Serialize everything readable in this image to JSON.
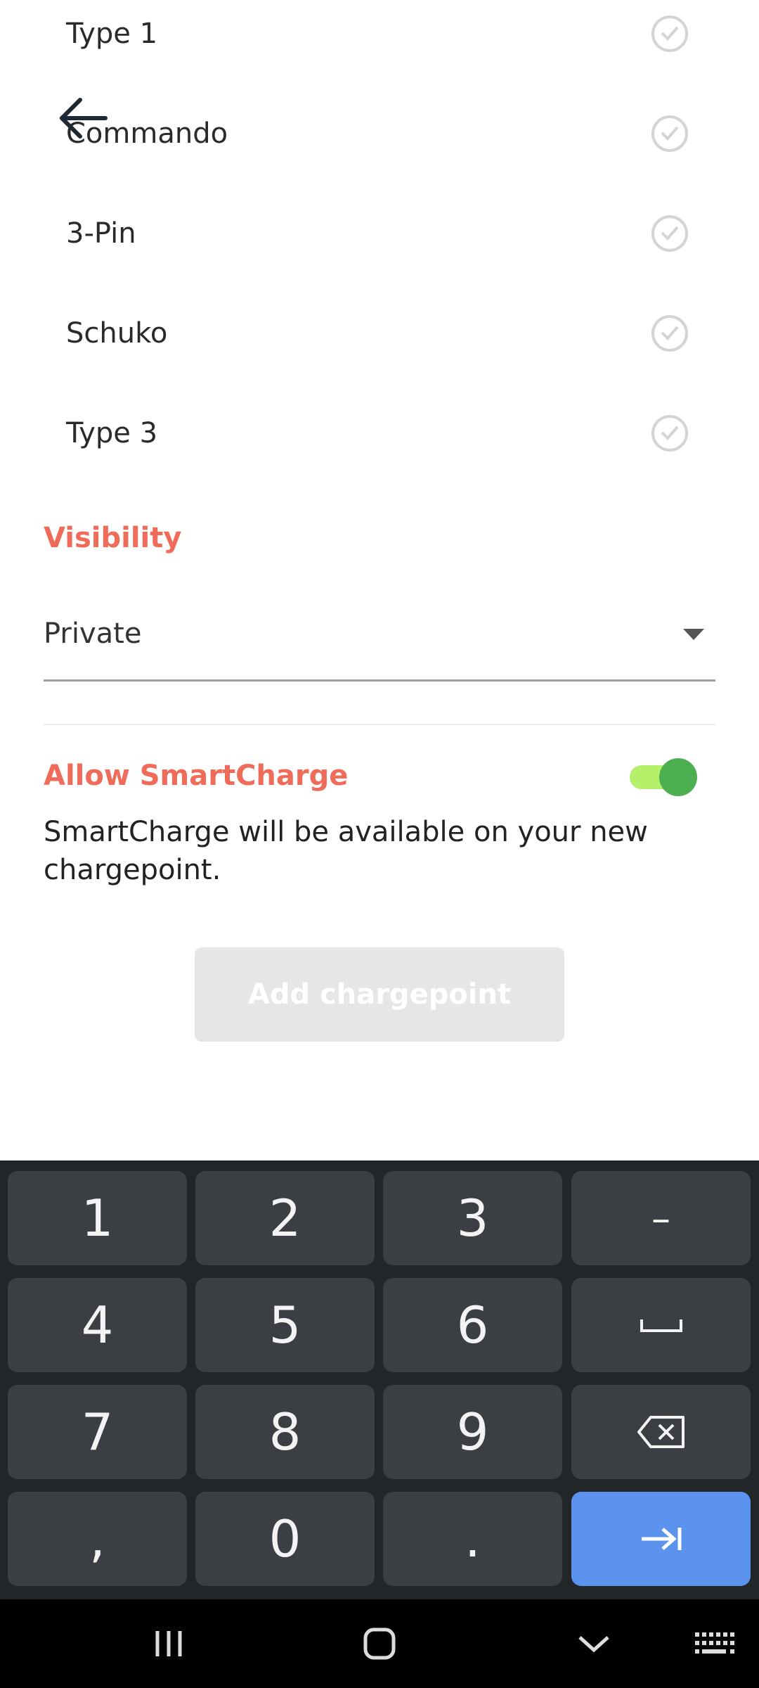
{
  "connectors": [
    {
      "label": "Type 1",
      "checked": false
    },
    {
      "label": "Commando",
      "checked": false
    },
    {
      "label": "3-Pin",
      "checked": false
    },
    {
      "label": "Schuko",
      "checked": false
    },
    {
      "label": "Type 3",
      "checked": false
    }
  ],
  "visibility": {
    "title": "Visibility",
    "selected": "Private"
  },
  "smartcharge": {
    "title": "Allow SmartCharge",
    "enabled": true,
    "description": "SmartCharge will be available on your new chargepoint."
  },
  "add_button": {
    "label": "Add chargepoint",
    "enabled": false
  },
  "keyboard": {
    "rows": [
      [
        "1",
        "2",
        "3",
        "–"
      ],
      [
        "4",
        "5",
        "6",
        "␣"
      ],
      [
        "7",
        "8",
        "9",
        "⌫"
      ],
      [
        ",",
        "0",
        ".",
        "⇥"
      ]
    ]
  },
  "colors": {
    "accent": "#ef6c5a",
    "toggle_track": "#b4f06a",
    "toggle_thumb": "#4caf50",
    "enter_key": "#5b93ee"
  }
}
